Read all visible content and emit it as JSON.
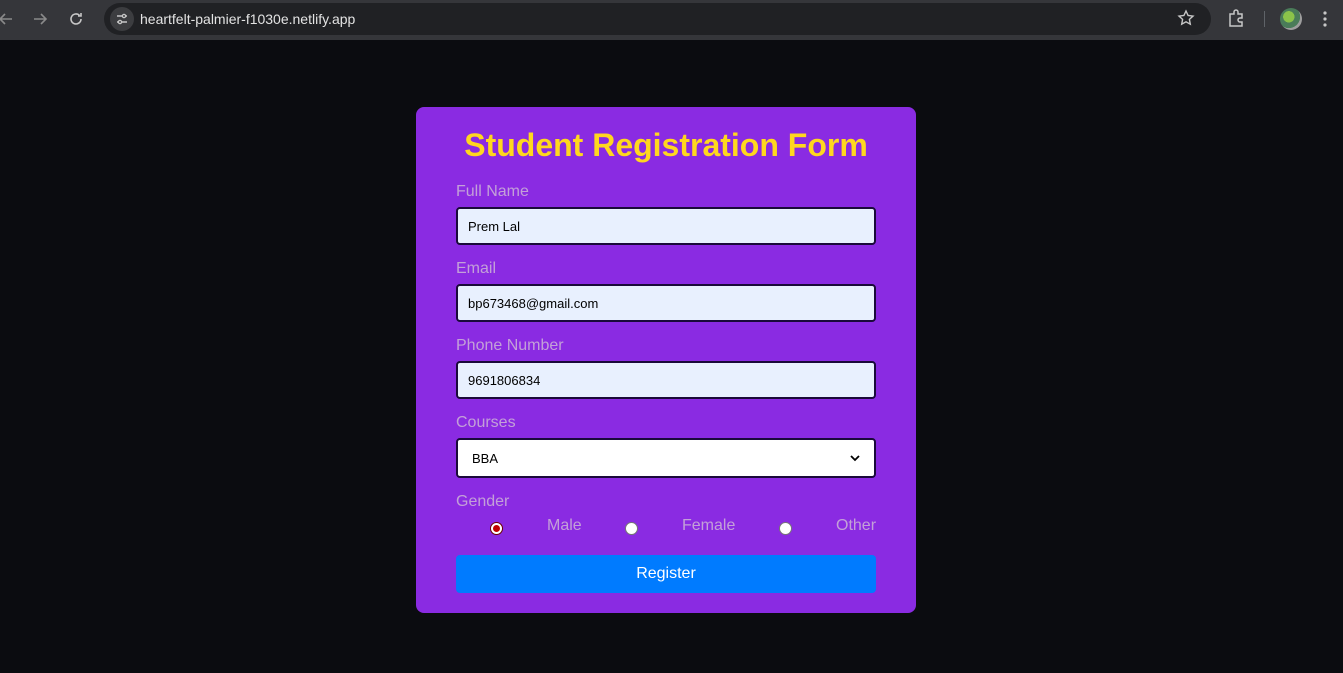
{
  "browser": {
    "url": "heartfelt-palmier-f1030e.netlify.app"
  },
  "form": {
    "title": "Student Registration Form",
    "full_name_label": "Full Name",
    "full_name_value": "Prem Lal",
    "email_label": "Email",
    "email_value": "bp673468@gmail.com",
    "phone_label": "Phone Number",
    "phone_value": "9691806834",
    "courses_label": "Courses",
    "courses_selected": "BBA",
    "gender_label": "Gender",
    "gender_options": [
      "Male",
      "Female",
      "Other"
    ],
    "gender_selected": "Male",
    "register_label": "Register"
  },
  "colors": {
    "page_bg": "#0b0c10",
    "card_bg": "#8a2be2",
    "title": "#ffd71f",
    "label": "#c3a0d8",
    "button": "#007bff"
  }
}
